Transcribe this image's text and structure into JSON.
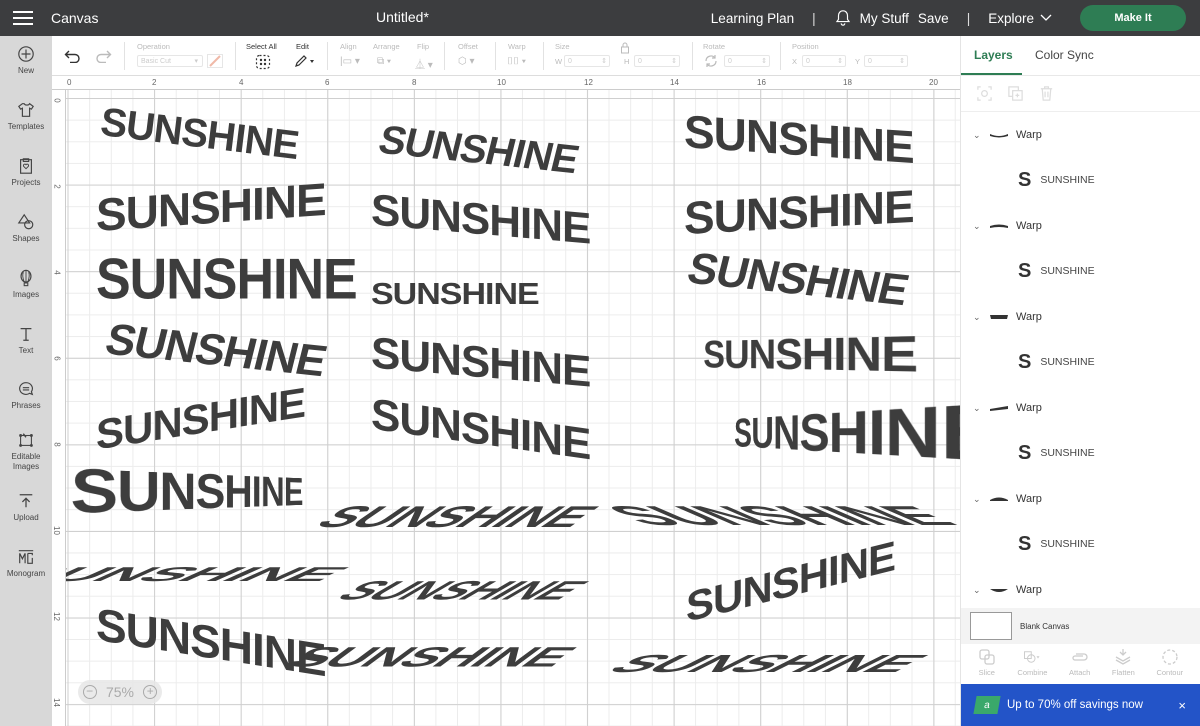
{
  "topbar": {
    "app_title": "Canvas",
    "doc_title": "Untitled*",
    "learning_plan": "Learning Plan",
    "my_stuff": "My Stuff",
    "save": "Save",
    "explore": "Explore",
    "make_it": "Make It",
    "separator": "|"
  },
  "sidebar": {
    "items": [
      {
        "label": "New",
        "icon": "plus-circle-icon"
      },
      {
        "label": "Templates",
        "icon": "tshirt-icon"
      },
      {
        "label": "Projects",
        "icon": "projects-icon"
      },
      {
        "label": "Shapes",
        "icon": "shapes-icon"
      },
      {
        "label": "Images",
        "icon": "balloon-icon"
      },
      {
        "label": "Text",
        "icon": "text-icon"
      },
      {
        "label": "Phrases",
        "icon": "speech-bubble-icon"
      },
      {
        "label": "Editable Images",
        "icon": "editable-images-icon"
      },
      {
        "label": "Upload",
        "icon": "upload-icon"
      },
      {
        "label": "Monogram",
        "icon": "monogram-icon"
      }
    ]
  },
  "toolbar": {
    "operation_label": "Operation",
    "operation_value": "Basic Cut",
    "select_all": "Select All",
    "edit": "Edit",
    "align": "Align",
    "arrange": "Arrange",
    "flip": "Flip",
    "offset": "Offset",
    "warp": "Warp",
    "size": "Size",
    "w_label": "W",
    "w_value": "0",
    "h_label": "H",
    "h_value": "0",
    "rotate": "Rotate",
    "rotate_value": "0",
    "position": "Position",
    "x_label": "X",
    "x_value": "0",
    "y_label": "Y",
    "y_value": "0"
  },
  "rulers": {
    "top": [
      "0",
      "2",
      "4",
      "6",
      "8",
      "10",
      "12",
      "14",
      "16",
      "18",
      "20"
    ],
    "left": [
      "0",
      "2",
      "4",
      "6",
      "8",
      "10",
      "12",
      "14"
    ]
  },
  "canvas": {
    "zoom_level": "75%",
    "word": "SUNSHINE",
    "text_color": "#3d3d3d"
  },
  "panel": {
    "tabs": [
      "Layers",
      "Color Sync"
    ],
    "active_tab": "Layers",
    "layers": [
      {
        "group": "Warp",
        "child": "SUNSHINE",
        "child_icon": "S"
      },
      {
        "group": "Warp",
        "child": "SUNSHINE",
        "child_icon": "S"
      },
      {
        "group": "Warp",
        "child": "SUNSHINE",
        "child_icon": "S"
      },
      {
        "group": "Warp",
        "child": "SUNSHINE",
        "child_icon": "S"
      },
      {
        "group": "Warp",
        "child": "SUNSHINE",
        "child_icon": "S"
      },
      {
        "group": "Warp"
      }
    ],
    "blank_canvas": "Blank Canvas",
    "ops": [
      "Slice",
      "Combine",
      "Attach",
      "Flatten",
      "Contour"
    ],
    "promo": "Up to 70% off savings now",
    "promo_close": "×",
    "promo_badge": "a"
  },
  "colors": {
    "topbar": "#3c3d3f",
    "accent_green": "#2e7d54",
    "promo_blue": "#2354c8"
  }
}
